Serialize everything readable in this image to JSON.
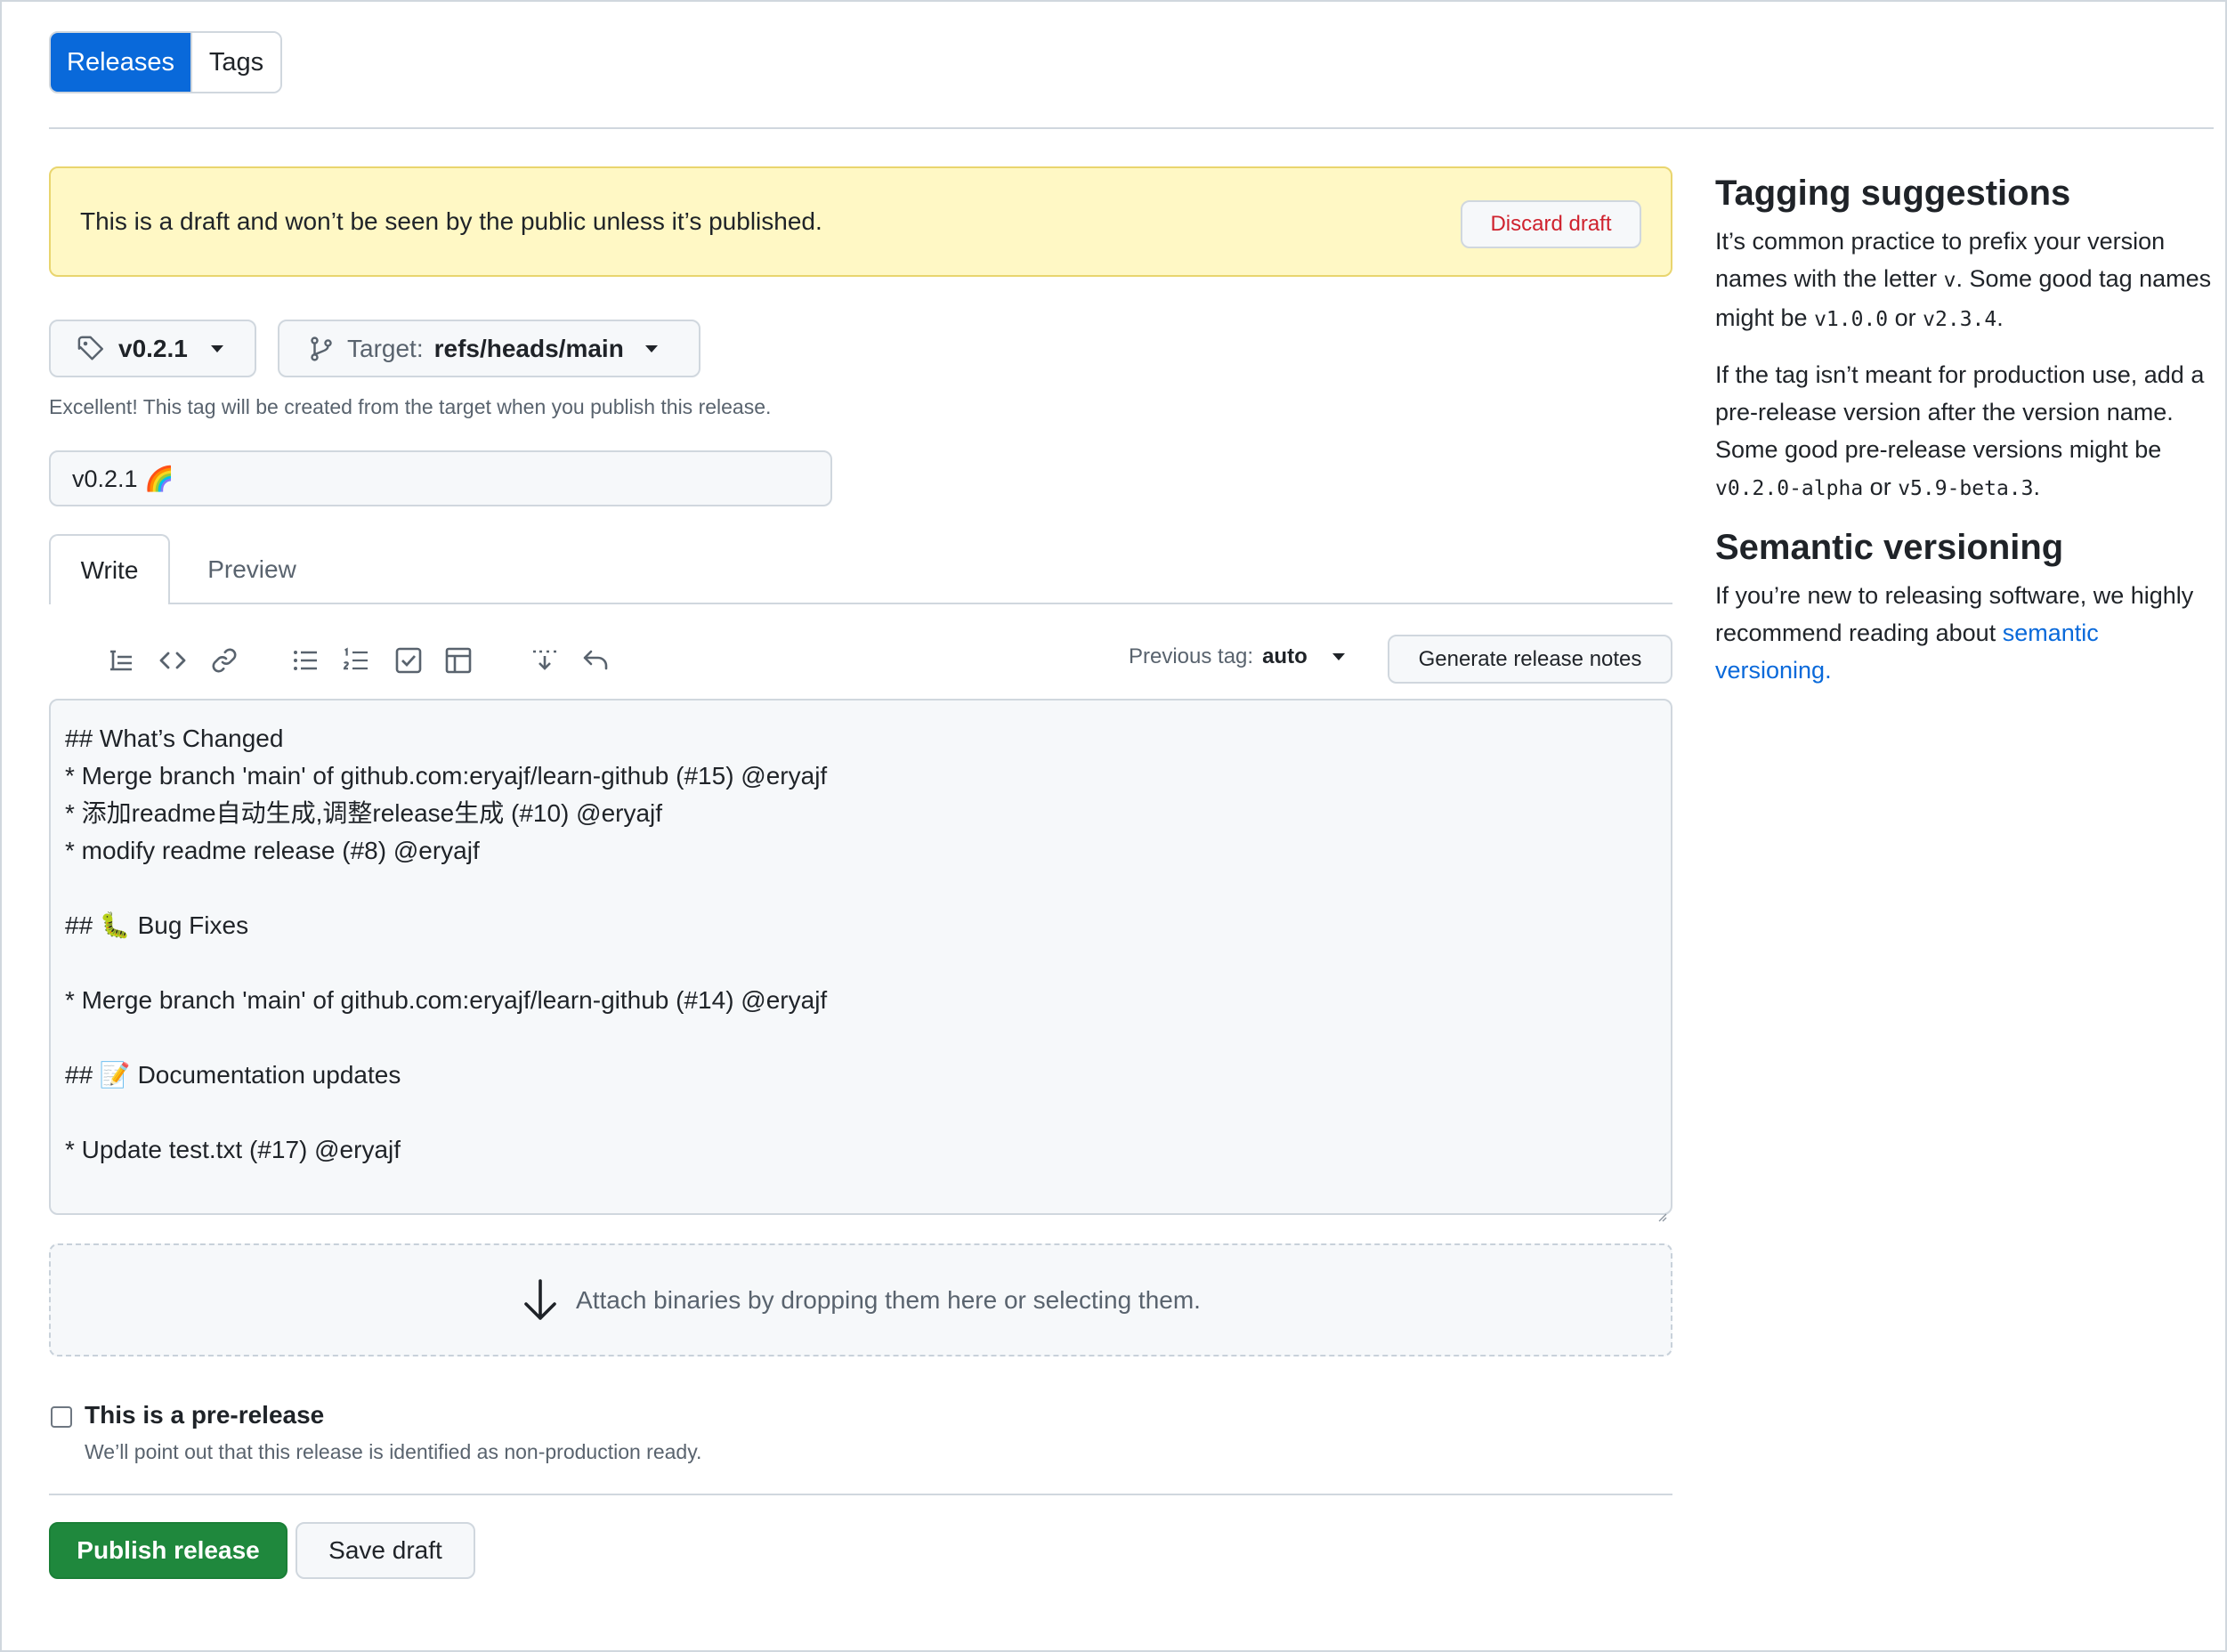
{
  "tabs": {
    "releases": "Releases",
    "tags": "Tags"
  },
  "flash": {
    "message": "This is a draft and won’t be seen by the public unless it’s published.",
    "discard_label": "Discard draft"
  },
  "tag": {
    "value": "v0.2.1",
    "target_label": "Target:",
    "target_value": "refs/heads/main",
    "hint": "Excellent! This tag will be created from the target when you publish this release."
  },
  "title_input": {
    "value": "v0.2.1 🌈"
  },
  "editor_tabs": {
    "write": "Write",
    "preview": "Preview"
  },
  "toolbar": {
    "icons": [
      "heading-icon",
      "code-icon",
      "link-icon",
      "unordered-list-icon",
      "ordered-list-icon",
      "task-list-icon",
      "table-icon",
      "details-icon",
      "undo-icon"
    ],
    "previous_tag_label": "Previous tag:",
    "previous_tag_value": "auto",
    "generate_label": "Generate release notes"
  },
  "editor": {
    "lines": [
      "## What’s Changed",
      "* Merge branch 'main' of github.com:eryajf/learn-github (#15) @eryajf",
      "* 添加readme自动生成,调整release生成 (#10) @eryajf",
      "* modify readme release (#8) @eryajf",
      "",
      "## 🐛 Bug Fixes",
      "",
      "* Merge branch 'main' of github.com:eryajf/learn-github (#14) @eryajf",
      "",
      "## 📝 Documentation updates",
      "",
      "* Update test.txt (#17) @eryajf"
    ]
  },
  "dropzone": {
    "text": "Attach binaries by dropping them here or selecting them."
  },
  "prerelease": {
    "label": "This is a pre-release",
    "note": "We’ll point out that this release is identified as non-production ready.",
    "checked": false
  },
  "actions": {
    "publish": "Publish release",
    "save_draft": "Save draft"
  },
  "sidebar": {
    "tagging_title": "Tagging suggestions",
    "tagging_p1_a": "It’s common practice to prefix your version names with the letter ",
    "tagging_p1_code1": "v",
    "tagging_p1_b": ". Some good tag names might be ",
    "tagging_p1_code2": "v1.0.0",
    "tagging_p1_c": " or ",
    "tagging_p1_code3": "v2.3.4",
    "tagging_p1_d": ".",
    "tagging_p2_a": "If the tag isn’t meant for production use, add a pre-release version after the version name. Some good pre-release versions might be ",
    "tagging_p2_code1": "v0.2.0-alpha",
    "tagging_p2_b": " or ",
    "tagging_p2_code2": "v5.9-beta.3",
    "tagging_p2_c": ".",
    "semver_title": "Semantic versioning",
    "semver_p_a": "If you’re new to releasing software, we highly recommend reading about ",
    "semver_link": "semantic versioning."
  },
  "colors": {
    "primary": "#0969da",
    "success": "#1f883d",
    "danger": "#cf222e",
    "flash_bg": "#fff8c5"
  }
}
